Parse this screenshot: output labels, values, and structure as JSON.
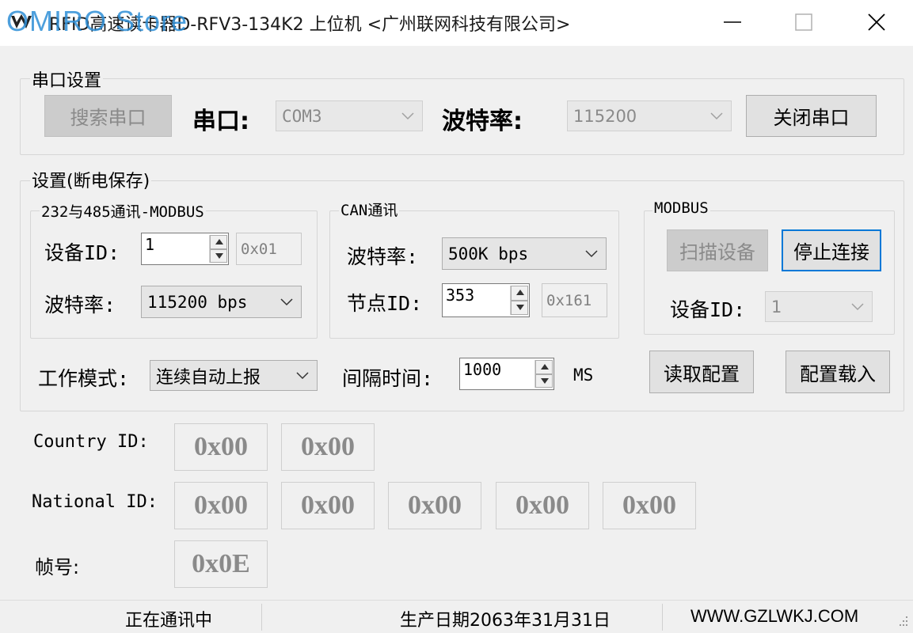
{
  "window": {
    "title": "RFID高速读卡器D-RFV3-134K2 上位机 <广州联网科技有限公司>",
    "watermark": "OMIRO Store"
  },
  "serial": {
    "group_title": "串口设置",
    "search_button": "搜索串口",
    "port_label": "串口:",
    "port_value": "COM3",
    "baud_label": "波特率:",
    "baud_value": "115200",
    "close_button": "关闭串口"
  },
  "settings": {
    "group_title": "设置(断电保存)",
    "modbus232": {
      "title": "232与485通讯-MODBUS",
      "device_id_label": "设备ID:",
      "device_id_value": "1",
      "device_id_hex": "0x01",
      "baud_label": "波特率:",
      "baud_value": "115200 bps"
    },
    "can": {
      "title": "CAN通讯",
      "baud_label": "波特率:",
      "baud_value": "500K bps",
      "node_id_label": "节点ID:",
      "node_id_value": "353",
      "node_id_hex": "0x161"
    },
    "modbus": {
      "title": "MODBUS",
      "scan_button": "扫描设备",
      "stop_button": "停止连接",
      "device_id_label": "设备ID:",
      "device_id_value": "1"
    },
    "work_mode_label": "工作模式:",
    "work_mode_value": "连续自动上报",
    "interval_label": "间隔时间:",
    "interval_value": "1000",
    "interval_unit": "MS",
    "read_config_button": "读取配置",
    "load_config_button": "配置载入"
  },
  "ids": {
    "country_label": "Country ID:",
    "country": [
      "0x00",
      "0x00"
    ],
    "national_label": "National ID:",
    "national": [
      "0x00",
      "0x00",
      "0x00",
      "0x00",
      "0x00"
    ],
    "frame_label": "帧号:",
    "frame": "0x0E"
  },
  "status": {
    "state": "正在通讯中",
    "production_date": "生产日期2063年31月31日",
    "website": "WWW.GZLWKJ.COM"
  }
}
